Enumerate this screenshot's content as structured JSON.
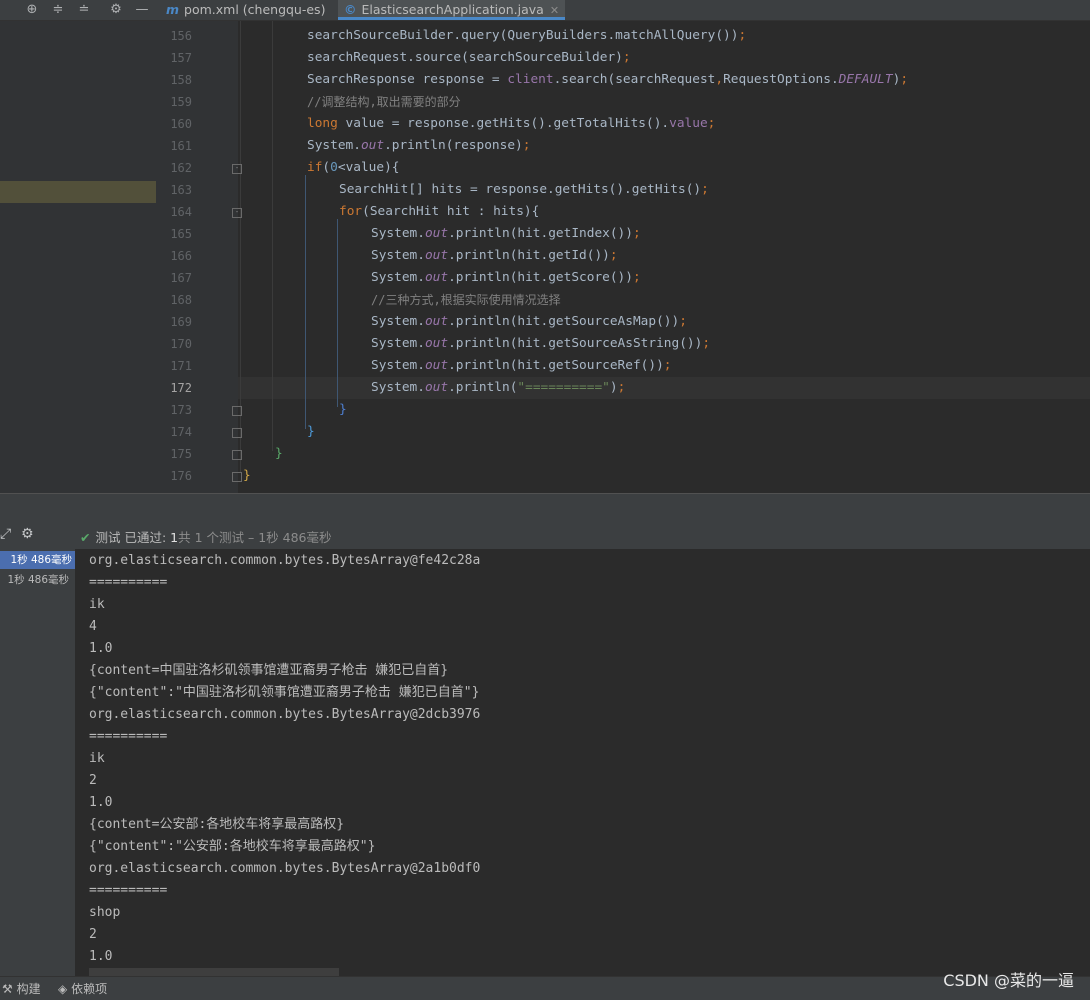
{
  "tabs": [
    {
      "icon": "m",
      "label": "pom.xml (chengqu-es)"
    },
    {
      "icon": "c",
      "label": "ElasticsearchApplication.java"
    }
  ],
  "editor": {
    "current_line": "172",
    "lines": [
      {
        "n": "156",
        "text": "searchSourceBuilder.query(QueryBuilders.matchAllQuery());"
      },
      {
        "n": "157",
        "text": "searchRequest.source(searchSourceBuilder);"
      },
      {
        "n": "158",
        "text": "SearchResponse response = client.search(searchRequest,RequestOptions.DEFAULT);"
      },
      {
        "n": "159",
        "text": "//调整结构,取出需要的部分"
      },
      {
        "n": "160",
        "text": "long value = response.getHits().getTotalHits().value;"
      },
      {
        "n": "161",
        "text": "System.out.println(response);"
      },
      {
        "n": "162",
        "text": "if(0<value){"
      },
      {
        "n": "163",
        "text": "SearchHit[] hits = response.getHits().getHits();"
      },
      {
        "n": "164",
        "text": "for(SearchHit hit : hits){"
      },
      {
        "n": "165",
        "text": "System.out.println(hit.getIndex());"
      },
      {
        "n": "166",
        "text": "System.out.println(hit.getId());"
      },
      {
        "n": "167",
        "text": "System.out.println(hit.getScore());"
      },
      {
        "n": "168",
        "text": "//三种方式,根据实际使用情况选择"
      },
      {
        "n": "169",
        "text": "System.out.println(hit.getSourceAsMap());"
      },
      {
        "n": "170",
        "text": "System.out.println(hit.getSourceAsString());"
      },
      {
        "n": "171",
        "text": "System.out.println(hit.getSourceRef());"
      },
      {
        "n": "172",
        "text": "System.out.println(\"==========\");"
      },
      {
        "n": "173",
        "text": "}"
      },
      {
        "n": "174",
        "text": "}"
      },
      {
        "n": "175",
        "text": "}"
      },
      {
        "n": "176",
        "text": "}"
      }
    ]
  },
  "run": {
    "status_label": "测试 已通过:",
    "status_count": "1",
    "status_rest": "共 1 个测试 – 1秒 486毫秒",
    "tree": [
      {
        "label": "1秒 486毫秒"
      },
      {
        "label": "1秒 486毫秒"
      }
    ],
    "output": [
      "org.elasticsearch.common.bytes.BytesArray@fe42c28a",
      "==========",
      "ik",
      "4",
      "1.0",
      "{content=中国驻洛杉矶领事馆遭亚裔男子枪击 嫌犯已自首}",
      "{\"content\":\"中国驻洛杉矶领事馆遭亚裔男子枪击 嫌犯已自首\"}",
      "org.elasticsearch.common.bytes.BytesArray@2dcb3976",
      "==========",
      "ik",
      "2",
      "1.0",
      "{content=公安部:各地校车将享最高路权}",
      "{\"content\":\"公安部:各地校车将享最高路权\"}",
      "org.elasticsearch.common.bytes.BytesArray@2a1b0df0",
      "==========",
      "shop",
      "2",
      "1.0"
    ]
  },
  "bottom": {
    "build_label": "构建",
    "deps_label": "依赖项",
    "watermark": "CSDN @菜的一逼"
  },
  "colors": {
    "background": "#2b2b2b",
    "keyword": "#cc7832",
    "string": "#6a8759",
    "field": "#9876aa",
    "comment": "#808080",
    "pass": "#59a869",
    "selection": "#4b6eaf"
  }
}
